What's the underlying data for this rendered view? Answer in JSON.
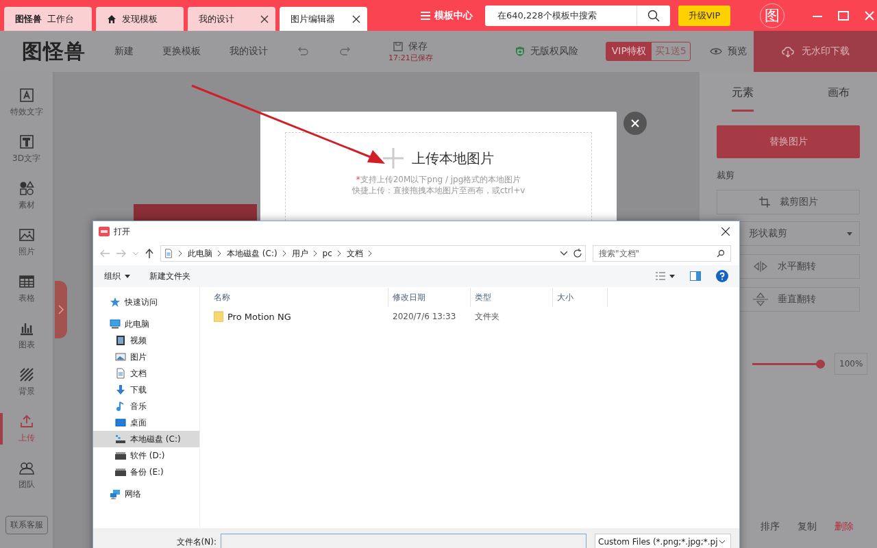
{
  "tabs": [
    {
      "kind": "brand",
      "brand": "图怪兽",
      "label": "工作台",
      "closable": false,
      "selected": false
    },
    {
      "kind": "home",
      "label": "发现模板",
      "closable": false,
      "selected": false
    },
    {
      "kind": "plain",
      "label": "我的设计",
      "closable": true,
      "selected": false
    },
    {
      "kind": "plain",
      "label": "图片编辑器",
      "closable": true,
      "selected": true
    }
  ],
  "topbar": {
    "menu": "模板中心",
    "search": {
      "placeholder": "在640,228个模板中搜索"
    },
    "upgrade": "升级VIP",
    "avatar": "图"
  },
  "toolbar": {
    "logo": "图怪兽",
    "nav": [
      "新建",
      "更换模板",
      "我的设计"
    ],
    "save": "保存",
    "saved_time": "17:21已保存",
    "copyright": "无版权风险",
    "vip": "VIP特权",
    "promo": "买1送5",
    "preview": "预览",
    "download": "无水印下载"
  },
  "sidebar": {
    "items": [
      {
        "label": "特效文字",
        "selected": false
      },
      {
        "label": "3D文字",
        "selected": false
      },
      {
        "label": "素材",
        "selected": false
      },
      {
        "label": "照片",
        "selected": false
      },
      {
        "label": "表格",
        "selected": false
      },
      {
        "label": "图表",
        "selected": false
      },
      {
        "label": "背景",
        "selected": false
      },
      {
        "label": "上传",
        "selected": true
      },
      {
        "label": "团队",
        "selected": false
      }
    ],
    "support": "联系客服"
  },
  "panel": {
    "tabs": [
      {
        "label": "元素",
        "selected": true
      },
      {
        "label": "画布",
        "selected": false
      }
    ],
    "replace": "替换图片",
    "crop_title": "裁剪",
    "crop": "裁剪图片",
    "shape_crop": "形状裁剪",
    "flip_h": "水平翻转",
    "flip_v": "垂直翻转",
    "opacity": {
      "level": 1,
      "reading": "100%"
    },
    "actions": [
      {
        "label": "排序",
        "danger": false
      },
      {
        "label": "复制",
        "danger": false
      },
      {
        "label": "删除",
        "danger": true
      }
    ]
  },
  "upload": {
    "title": "上传本地图片",
    "note_mark": "*",
    "note": "支持上传20M以下png / jpg格式的本地图片",
    "hint": "快捷上传：直接拖拽本地图片至画布，或ctrl+v"
  },
  "file_dialog": {
    "title": "打开",
    "path": [
      "此电脑",
      "本地磁盘 (C:)",
      "用户",
      "pc",
      "文档"
    ],
    "search": {
      "placeholder": "搜索\"文档\""
    },
    "organize": "组织",
    "new_folder": "新建文件夹",
    "tree": [
      {
        "label": "快速访问",
        "selected": false
      },
      {
        "label": "此电脑",
        "selected": false,
        "children": [
          {
            "label": "视频",
            "selected": false
          },
          {
            "label": "图片",
            "selected": false
          },
          {
            "label": "文档",
            "selected": false
          },
          {
            "label": "下载",
            "selected": false
          },
          {
            "label": "音乐",
            "selected": false
          },
          {
            "label": "桌面",
            "selected": false
          },
          {
            "label": "本地磁盘 (C:)",
            "selected": true
          },
          {
            "label": "软件 (D:)",
            "selected": false
          },
          {
            "label": "备份 (E:)",
            "selected": false
          }
        ]
      },
      {
        "label": "网络",
        "selected": false
      }
    ],
    "columns": [
      "名称",
      "修改日期",
      "类型",
      "大小"
    ],
    "rows": [
      {
        "name": "Pro Motion NG",
        "modified": "2020/7/6 13:33",
        "type": "文件夹"
      }
    ],
    "filename_label": "文件名(N):",
    "filetype": "Custom Files (*.png;*.jpg;*.pj"
  }
}
